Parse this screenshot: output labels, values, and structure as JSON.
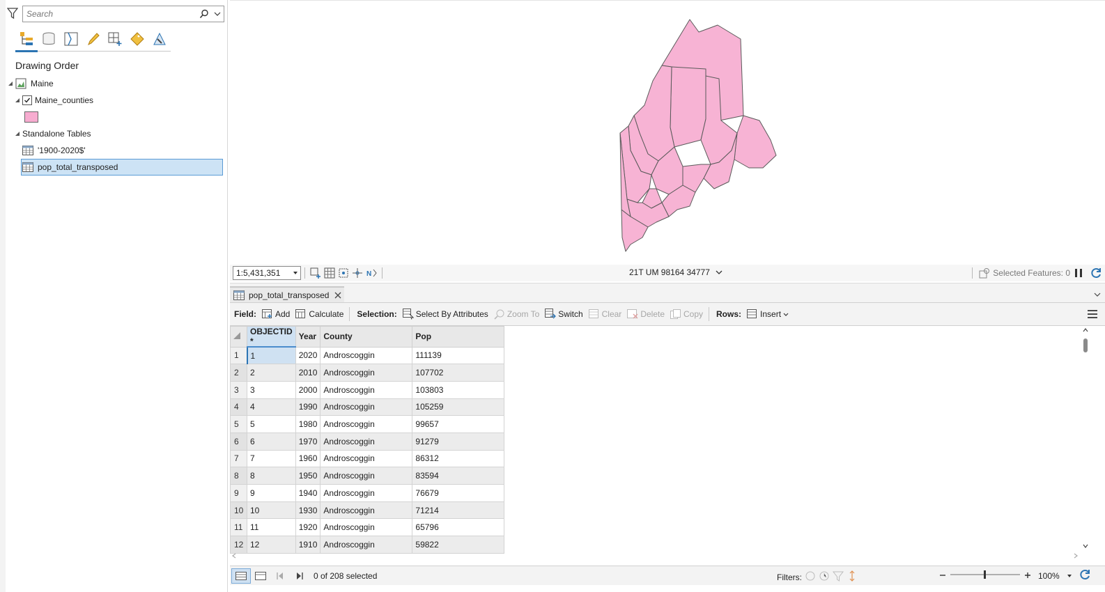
{
  "contents_pane": {
    "search_placeholder": "Search",
    "heading": "Drawing Order",
    "map_name": "Maine",
    "layer_name": "Maine_counties",
    "layer_checked": true,
    "layer_symbol_color": "#f7acd0",
    "standalone_heading": "Standalone Tables",
    "tables": [
      "'1900-2020$'",
      "pop_total_transposed"
    ],
    "selected_table_index": 1,
    "view_tabs": [
      "list-by-drawing-order-icon",
      "list-by-source-icon",
      "list-by-selection-icon",
      "list-by-editing-icon",
      "list-by-snapping-icon",
      "list-by-labeling-icon",
      "list-by-perspective-icon"
    ]
  },
  "map": {
    "fill_color": "#f7b3d4",
    "outline_color": "#5a5a5a"
  },
  "map_status": {
    "scale": "1:5,431,351",
    "coordinates": "21T UM 98164 34777",
    "selected_features": "Selected Features: 0"
  },
  "table_view": {
    "tab_title": "pop_total_transposed",
    "toolbar": {
      "field_label": "Field:",
      "add": "Add",
      "calculate": "Calculate",
      "selection_label": "Selection:",
      "select_by_attributes": "Select By Attributes",
      "zoom_to": "Zoom To",
      "switch": "Switch",
      "clear": "Clear",
      "delete": "Delete",
      "copy": "Copy",
      "rows_label": "Rows:",
      "insert": "Insert"
    },
    "columns": [
      "OBJECTID *",
      "Year",
      "County",
      "Pop"
    ],
    "rows": [
      [
        "1",
        "1",
        "2020",
        "Androscoggin",
        "111139"
      ],
      [
        "2",
        "2",
        "2010",
        "Androscoggin",
        "107702"
      ],
      [
        "3",
        "3",
        "2000",
        "Androscoggin",
        "103803"
      ],
      [
        "4",
        "4",
        "1990",
        "Androscoggin",
        "105259"
      ],
      [
        "5",
        "5",
        "1980",
        "Androscoggin",
        "99657"
      ],
      [
        "6",
        "6",
        "1970",
        "Androscoggin",
        "91279"
      ],
      [
        "7",
        "7",
        "1960",
        "Androscoggin",
        "86312"
      ],
      [
        "8",
        "8",
        "1950",
        "Androscoggin",
        "83594"
      ],
      [
        "9",
        "9",
        "1940",
        "Androscoggin",
        "76679"
      ],
      [
        "10",
        "10",
        "1930",
        "Androscoggin",
        "71214"
      ],
      [
        "11",
        "11",
        "1920",
        "Androscoggin",
        "65796"
      ],
      [
        "12",
        "12",
        "1910",
        "Androscoggin",
        "59822"
      ]
    ],
    "status": {
      "selected_text": "0 of 208 selected",
      "filters_label": "Filters:",
      "zoom": "100%"
    }
  }
}
